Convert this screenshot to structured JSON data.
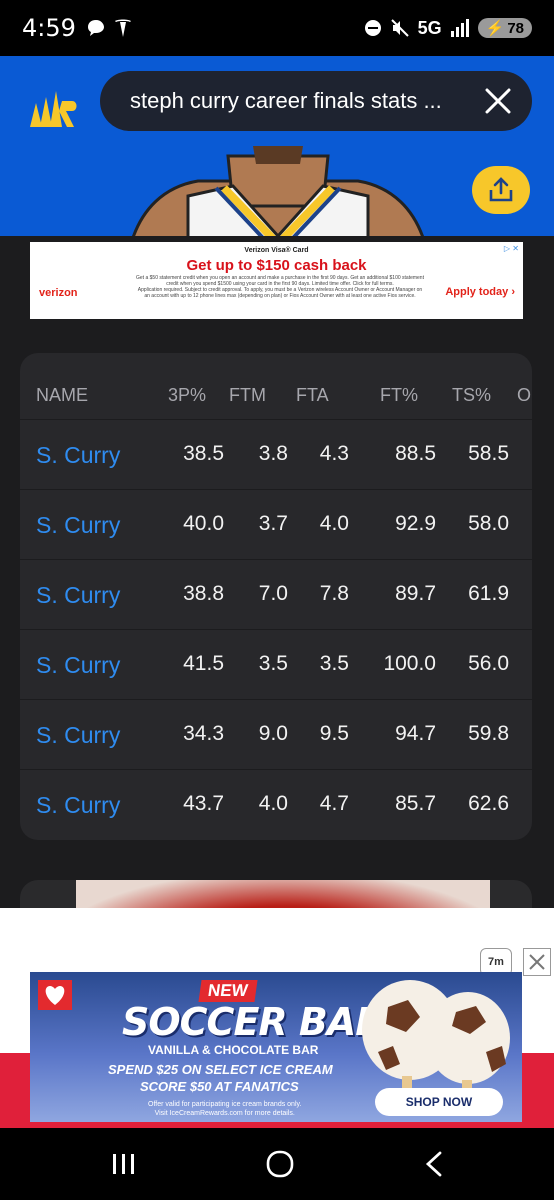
{
  "status_bar": {
    "time": "4:59",
    "network": "5G",
    "battery": "78"
  },
  "search": {
    "query": "steph curry career finals stats ..."
  },
  "ad_top": {
    "label": "Verizon Visa® Card",
    "headline": "Get up to $150 cash back",
    "fine_print": "Get a $50 statement credit when you open an account and make a purchase in the first 90 days. Get an additional $100 statement credit when you spend $1500 using your card in the first 90 days. Limited time offer. Click for full terms.",
    "fine_print_2": "Application required. Subject to credit approval. To apply, you must be a Verizon wireless Account Owner or Account Manager on an account with up to 12 phone lines max (depending on plan) or Fios Account Owner with at least one active Fios service.",
    "brand": "verizon",
    "cta": "Apply today"
  },
  "table": {
    "headers": [
      "NAME",
      "3P%",
      "FTM",
      "FTA",
      "FT%",
      "TS%",
      "O"
    ],
    "rows": [
      {
        "name": "S. Curry",
        "p3": "38.5",
        "ftm": "3.8",
        "fta": "4.3",
        "ftp": "88.5",
        "ts": "58.5"
      },
      {
        "name": "S. Curry",
        "p3": "40.0",
        "ftm": "3.7",
        "fta": "4.0",
        "ftp": "92.9",
        "ts": "58.0"
      },
      {
        "name": "S. Curry",
        "p3": "38.8",
        "ftm": "7.0",
        "fta": "7.8",
        "ftp": "89.7",
        "ts": "61.9"
      },
      {
        "name": "S. Curry",
        "p3": "41.5",
        "ftm": "3.5",
        "fta": "3.5",
        "ftp": "100.0",
        "ts": "56.0"
      },
      {
        "name": "S. Curry",
        "p3": "34.3",
        "ftm": "9.0",
        "fta": "9.5",
        "ftp": "94.7",
        "ts": "59.8"
      },
      {
        "name": "S. Curry",
        "p3": "43.7",
        "ftm": "4.0",
        "fta": "4.7",
        "ftp": "85.7",
        "ts": "62.6"
      }
    ]
  },
  "ad_bottom": {
    "new": "NEW",
    "title": "SOCCER BALL",
    "subtitle": "VANILLA & CHOCOLATE BAR",
    "spend": "SPEND $25 ON SELECT ICE CREAM",
    "score": "SCORE $50 AT FANATICS",
    "offer": "Offer valid for participating ice cream brands only.\nVisit IceCreamRewards.com for more details.",
    "cta": "SHOP NOW"
  },
  "colors": {
    "header_blue": "#0a5ad4",
    "accent_yellow": "#f7c72a",
    "link_blue": "#2f8cf0"
  }
}
